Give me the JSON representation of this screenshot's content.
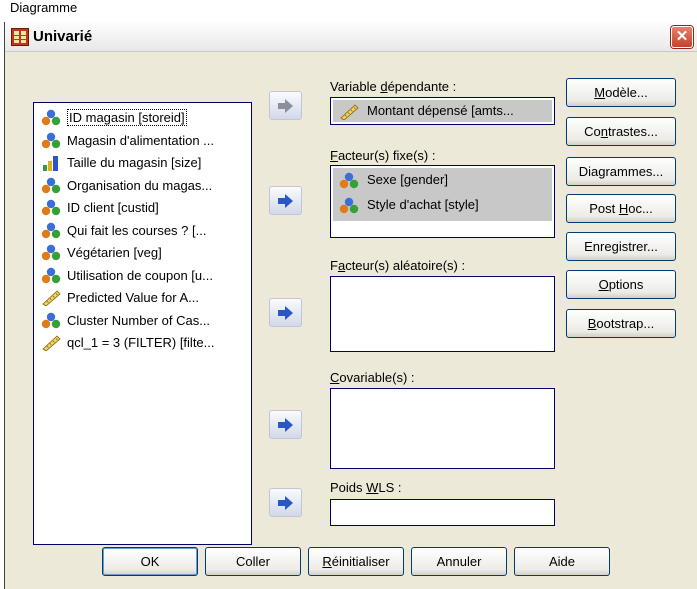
{
  "top_text": "Diagramme",
  "window": {
    "title": "Univarié",
    "close": "✕"
  },
  "variables": [
    {
      "label": "ID magasin [storeid]",
      "icon": "nominal-icon",
      "selected": true
    },
    {
      "label": "Magasin d'alimentation ...",
      "icon": "nominal-icon"
    },
    {
      "label": "Taille du magasin [size]",
      "icon": "ordinal-icon"
    },
    {
      "label": "Organisation du magas...",
      "icon": "nominal-icon"
    },
    {
      "label": "ID client [custid]",
      "icon": "nominal-icon"
    },
    {
      "label": "Qui fait les courses ? [...",
      "icon": "nominal-icon"
    },
    {
      "label": "Végétarien [veg]",
      "icon": "nominal-icon"
    },
    {
      "label": "Utilisation de coupon [u...",
      "icon": "nominal-icon"
    },
    {
      "label": "Predicted Value for A...",
      "icon": "scale-icon"
    },
    {
      "label": "Cluster Number of Cas...",
      "icon": "nominal-icon"
    },
    {
      "label": "qcl_1 = 3 (FILTER) [filte...",
      "icon": "scale-icon"
    }
  ],
  "dependent": {
    "label_before": "Variable ",
    "label_underline": "d",
    "label_after": "épendante :",
    "value": "Montant dépensé [amts..."
  },
  "fixed": {
    "label_before": "",
    "label_underline": "F",
    "label_after": "acteur(s) fixe(s) :",
    "items": [
      "Sexe [gender]",
      "Style d'achat [style]"
    ]
  },
  "random": {
    "label_before": "F",
    "label_underline": "a",
    "label_after": "cteur(s) aléatoire(s) :"
  },
  "covariate": {
    "label_before": "",
    "label_underline": "C",
    "label_after": "ovariable(s) :"
  },
  "wls": {
    "label_before": "Poids ",
    "label_underline": "W",
    "label_after": "LS :"
  },
  "side_buttons": [
    {
      "before": "",
      "ul": "M",
      "after": "odèle..."
    },
    {
      "before": "Co",
      "ul": "n",
      "after": "trastes..."
    },
    {
      "before": "Diagrammes...",
      "ul": "",
      "after": ""
    },
    {
      "before": "Post ",
      "ul": "H",
      "after": "oc..."
    },
    {
      "before": "Enre",
      "ul": "g",
      "after": "istrer..."
    },
    {
      "before": "",
      "ul": "O",
      "after": "ptions"
    },
    {
      "before": "",
      "ul": "B",
      "after": "ootstrap..."
    }
  ],
  "bottom_buttons": [
    {
      "before": "OK",
      "ul": "",
      "after": ""
    },
    {
      "before": "Coller",
      "ul": "",
      "after": ""
    },
    {
      "before": "",
      "ul": "R",
      "after": "éinitialiser"
    },
    {
      "before": "Annuler",
      "ul": "",
      "after": ""
    },
    {
      "before": "Aide",
      "ul": "",
      "after": ""
    }
  ]
}
